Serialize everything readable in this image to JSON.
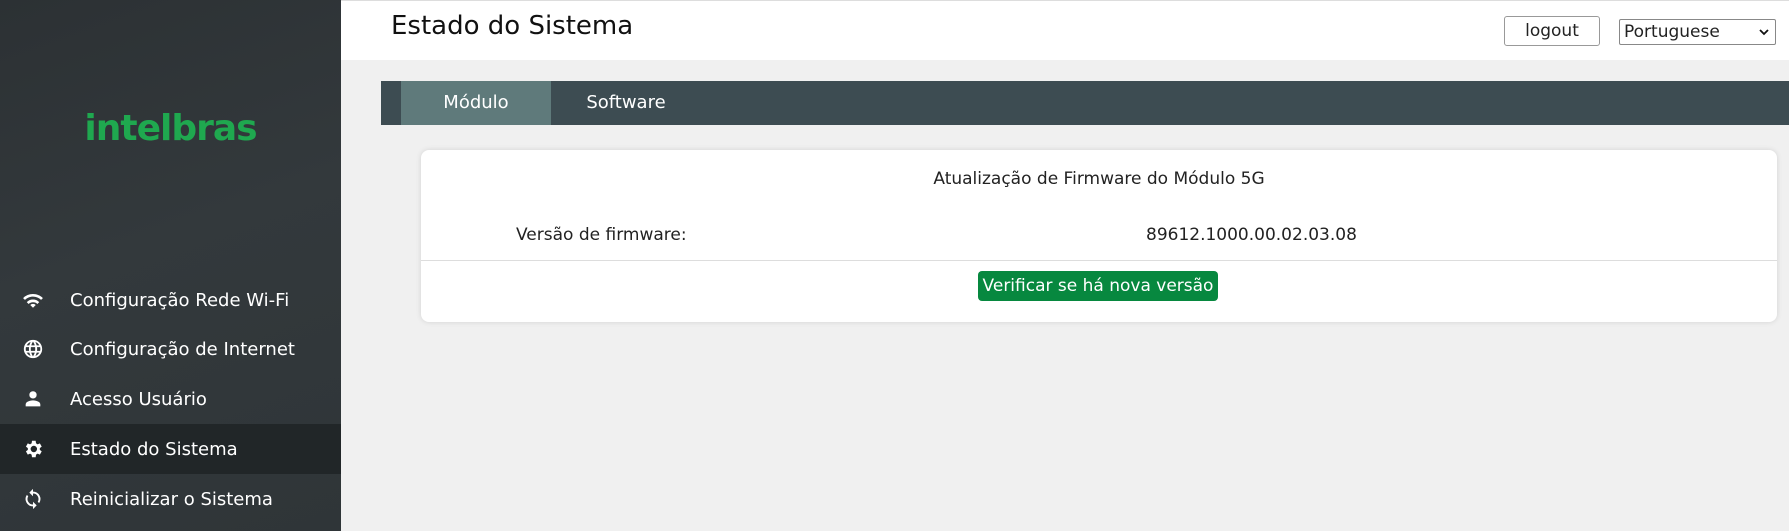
{
  "sidebar": {
    "logo_text": "intelbras",
    "items": [
      {
        "label": "Configuração Rede Wi-Fi",
        "icon": "wifi-icon"
      },
      {
        "label": "Configuração de Internet",
        "icon": "globe-icon"
      },
      {
        "label": "Acesso Usuário",
        "icon": "user-icon"
      },
      {
        "label": "Estado do Sistema",
        "icon": "gear-icon",
        "active": true
      },
      {
        "label": "Reinicializar o Sistema",
        "icon": "refresh-icon"
      }
    ]
  },
  "header": {
    "title": "Estado do Sistema",
    "logout_label": "logout",
    "language": "Portuguese"
  },
  "tabs": [
    {
      "label": "Módulo",
      "active": true
    },
    {
      "label": "Software",
      "active": false
    }
  ],
  "card": {
    "title": "Atualização de Firmware do Módulo 5G",
    "firmware_label": "Versão de firmware:",
    "firmware_value": "89612.1000.00.02.03.08",
    "check_button": "Verificar se há nova versão"
  },
  "colors": {
    "brand_green": "#1fa84f",
    "button_green": "#07883f",
    "tab_bar": "#3d4c52",
    "tab_active": "#5f7a7b",
    "sidebar_bg": "#2f3538"
  }
}
